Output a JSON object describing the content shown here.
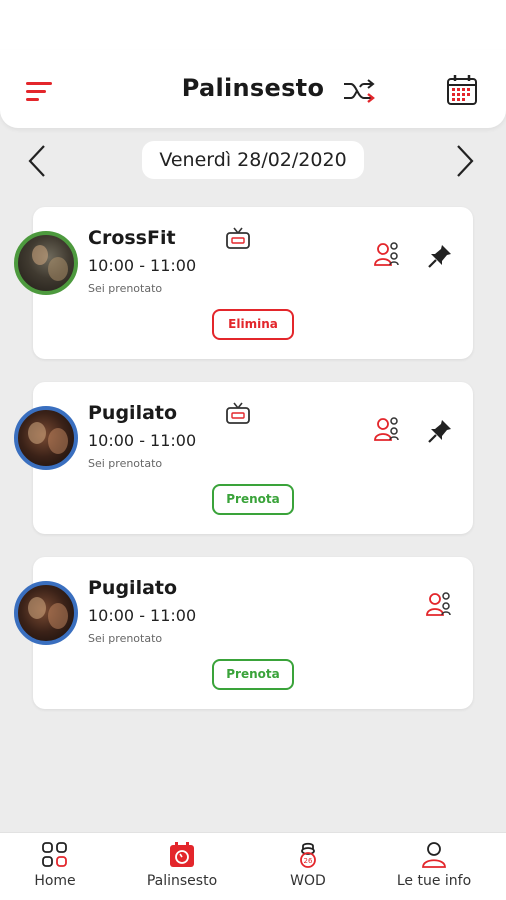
{
  "header": {
    "title": "Palinsesto",
    "accent_color": "#e3262b"
  },
  "date_nav": {
    "current_date": "Venerdì 28/02/2020"
  },
  "classes": [
    {
      "name": "CrossFit",
      "time": "10:00 - 11:00",
      "status": "Sei prenotato",
      "action": "Elimina",
      "action_color": "#e3262b",
      "avatar_ring": "#4d9a3e"
    },
    {
      "name": "Pugilato",
      "time": "10:00 - 11:00",
      "status": "Sei prenotato",
      "action": "Prenota",
      "action_color": "#3aa33a",
      "avatar_ring": "#3a6fbf"
    },
    {
      "name": "Pugilato",
      "time": "10:00 - 11:00",
      "status": "Sei prenotato",
      "action": "Prenota",
      "action_color": "#3aa33a",
      "avatar_ring": "#3a6fbf"
    }
  ],
  "bottom_nav": [
    {
      "label": "Home",
      "icon": "home-grid-icon"
    },
    {
      "label": "Palinsesto",
      "icon": "calendar-active-icon",
      "active": true
    },
    {
      "label": "WOD",
      "icon": "wod-icon"
    },
    {
      "label": "Le tue info",
      "icon": "profile-icon"
    }
  ]
}
